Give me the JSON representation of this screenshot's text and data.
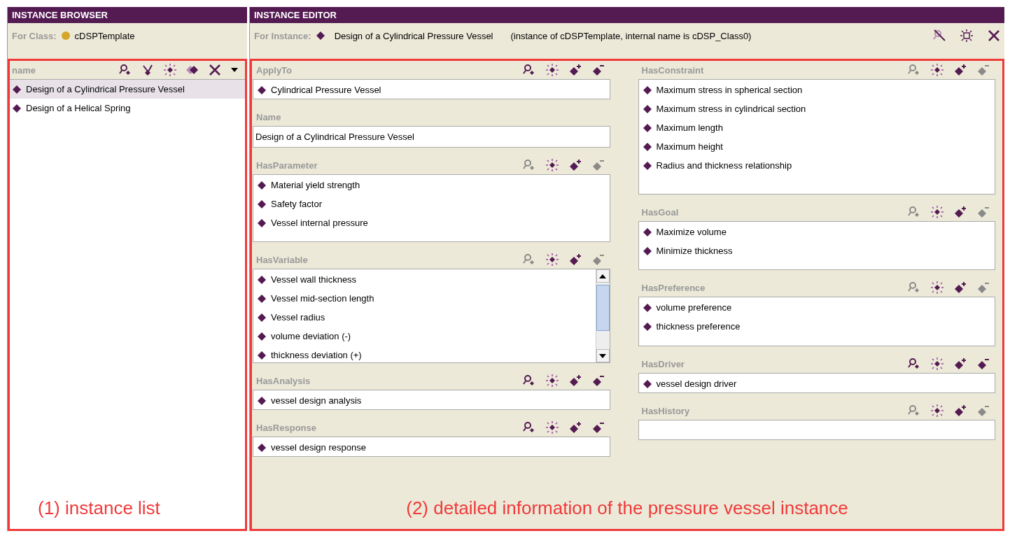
{
  "browser": {
    "title": "INSTANCE BROWSER",
    "for_class_label": "For Class:",
    "class_name": "cDSPTemplate",
    "column_header": "name",
    "instances": [
      {
        "name": "Design of a Cylindrical Pressure Vessel",
        "selected": true
      },
      {
        "name": "Design of a Helical Spring",
        "selected": false
      }
    ]
  },
  "editor": {
    "title": "INSTANCE EDITOR",
    "for_instance_label": "For Instance:",
    "instance_name": "Design of a Cylindrical Pressure Vessel",
    "instance_info": "(instance of cDSPTemplate, internal name is cDSP_Class0)",
    "columns": [
      [
        {
          "label": "ApplyTo",
          "kind": "single",
          "tools_enabled": true,
          "values": [
            "Cylindrical Pressure Vessel"
          ]
        },
        {
          "label": "Name",
          "kind": "text",
          "value": "Design of a Cylindrical Pressure Vessel"
        },
        {
          "label": "HasParameter",
          "kind": "list",
          "tools_enabled": false,
          "values": [
            "Material yield strength",
            "Safety factor",
            "Vessel internal pressure"
          ]
        },
        {
          "label": "HasVariable",
          "kind": "list",
          "tools_enabled": false,
          "values": [
            "Vessel wall thickness",
            "Vessel mid-section length",
            "Vessel radius",
            "volume deviation (-)",
            "thickness deviation (+)"
          ]
        },
        {
          "label": "HasAnalysis",
          "kind": "single",
          "tools_enabled": true,
          "values": [
            "vessel design analysis"
          ]
        },
        {
          "label": "HasResponse",
          "kind": "single",
          "tools_enabled": true,
          "values": [
            "vessel design response"
          ]
        }
      ],
      [
        {
          "label": "HasConstraint",
          "kind": "list",
          "tools_enabled": false,
          "values": [
            "Maximum stress in spherical section",
            "Maximum stress in cylindrical section",
            "Maximum length",
            "Maximum height",
            "Radius and thickness relationship"
          ]
        },
        {
          "label": "HasGoal",
          "kind": "list",
          "tools_enabled": false,
          "values": [
            "Maximize volume",
            "Minimize thickness"
          ]
        },
        {
          "label": "HasPreference",
          "kind": "list",
          "tools_enabled": false,
          "values": [
            "volume preference",
            "thickness preference"
          ]
        },
        {
          "label": "HasDriver",
          "kind": "single",
          "tools_enabled": true,
          "values": [
            "vessel design driver"
          ]
        },
        {
          "label": "HasHistory",
          "kind": "single",
          "tools_enabled": false
        }
      ]
    ]
  },
  "annotations": [
    {
      "text": "(1) instance list"
    },
    {
      "text": "(2) detailed information of the pressure vessel instance"
    }
  ]
}
